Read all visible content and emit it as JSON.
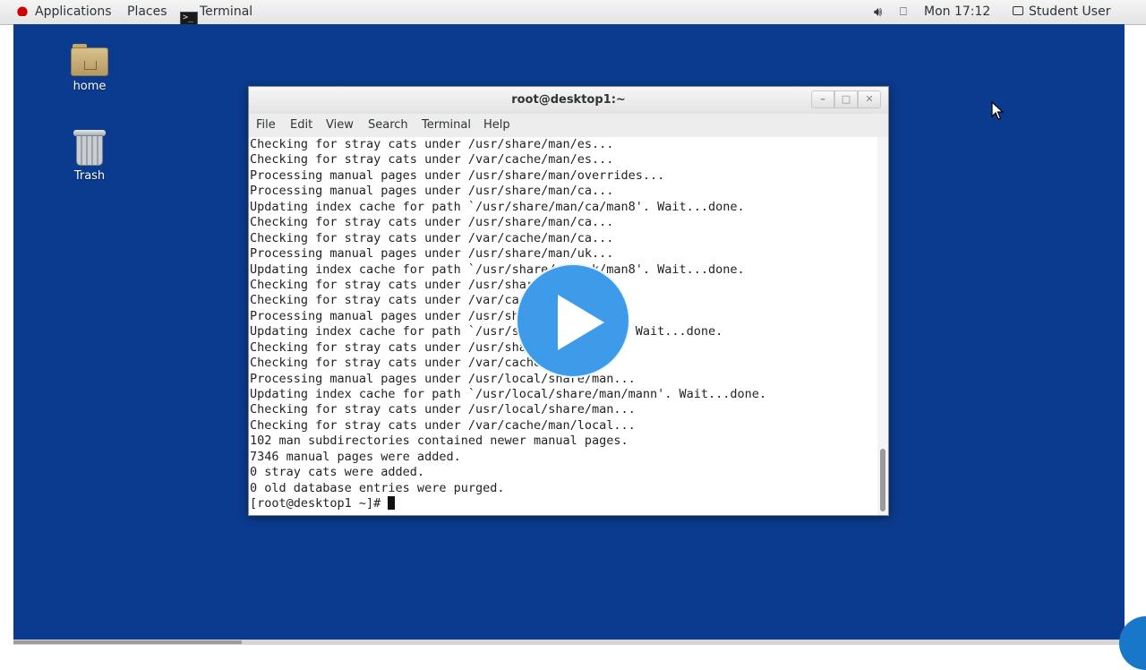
{
  "top_panel": {
    "applications": "Applications",
    "places": "Places",
    "terminal_task": "Terminal",
    "clock": "Mon 17:12",
    "user": "Student User",
    "volume_icon": "volume-icon",
    "network_icon": "network-icon"
  },
  "desktop": {
    "icons": [
      {
        "label": "home",
        "icon": "home-folder-icon"
      },
      {
        "label": "Trash",
        "icon": "trash-icon"
      }
    ]
  },
  "terminal": {
    "title": "root@desktop1:~",
    "menu": [
      "File",
      "Edit",
      "View",
      "Search",
      "Terminal",
      "Help"
    ],
    "lines": [
      "Checking for stray cats under /usr/share/man/es...",
      "Checking for stray cats under /var/cache/man/es...",
      "Processing manual pages under /usr/share/man/overrides...",
      "Processing manual pages under /usr/share/man/ca...",
      "Updating index cache for path `/usr/share/man/ca/man8'. Wait...done.",
      "Checking for stray cats under /usr/share/man/ca...",
      "Checking for stray cats under /var/cache/man/ca...",
      "Processing manual pages under /usr/share/man/uk...",
      "Updating index cache for path `/usr/share/man/uk/man8'. Wait...done.",
      "Checking for stray cats under /usr/share/man/uk...",
      "Checking for stray cats under /var/cache/man/uk...",
      "Processing manual pages under /usr/share/man...",
      "Updating index cache for path `/usr/share/man/man7'. Wait...done.",
      "Checking for stray cats under /usr/share/man...",
      "Checking for stray cats under /var/cache/man...",
      "Processing manual pages under /usr/local/share/man...",
      "Updating index cache for path `/usr/local/share/man/mann'. Wait...done.",
      "Checking for stray cats under /usr/local/share/man...",
      "Checking for stray cats under /var/cache/man/local...",
      "102 man subdirectories contained newer manual pages.",
      "7346 manual pages were added.",
      "0 stray cats were added.",
      "0 old database entries were purged."
    ],
    "prompt": "[root@desktop1 ~]# "
  },
  "overlay": {
    "play_icon": "play-icon",
    "color": "#3d9be9"
  },
  "colors": {
    "desktop": "#0b3b8e",
    "panel": "#ececec",
    "accent": "#1877c9"
  }
}
